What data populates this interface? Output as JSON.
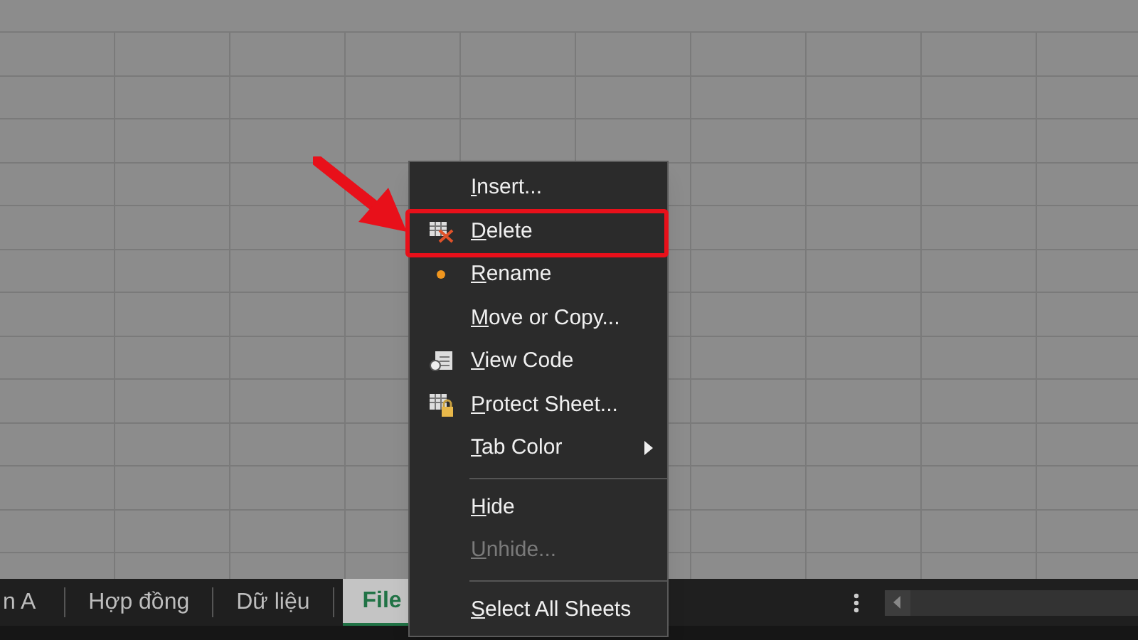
{
  "context_menu": {
    "items": [
      {
        "kind": "plain",
        "label": "Insert...",
        "disabled": false,
        "annotated": false
      },
      {
        "kind": "delete",
        "label": "Delete",
        "disabled": false,
        "annotated": true
      },
      {
        "kind": "rename",
        "label": "Rename",
        "disabled": false,
        "annotated": false
      },
      {
        "kind": "plain",
        "label": "Move or Copy...",
        "disabled": false,
        "annotated": false
      },
      {
        "kind": "code",
        "label": "View Code",
        "disabled": false,
        "annotated": false
      },
      {
        "kind": "protect",
        "label": "Protect Sheet...",
        "disabled": false,
        "annotated": false
      },
      {
        "kind": "submenu",
        "label": "Tab Color",
        "disabled": false,
        "annotated": false
      },
      {
        "kind": "separator"
      },
      {
        "kind": "plain",
        "label": "Hide",
        "disabled": false,
        "annotated": false
      },
      {
        "kind": "plain",
        "label": "Unhide...",
        "disabled": true,
        "annotated": false
      },
      {
        "kind": "separator"
      },
      {
        "kind": "plain",
        "label": "Select All Sheets",
        "disabled": false,
        "annotated": false
      }
    ]
  },
  "sheet_tabs": [
    {
      "label": "n A",
      "selected": false
    },
    {
      "label": "Hợp đồng",
      "selected": false
    },
    {
      "label": "Dữ liệu",
      "selected": false
    },
    {
      "label": "File",
      "selected": true
    }
  ]
}
